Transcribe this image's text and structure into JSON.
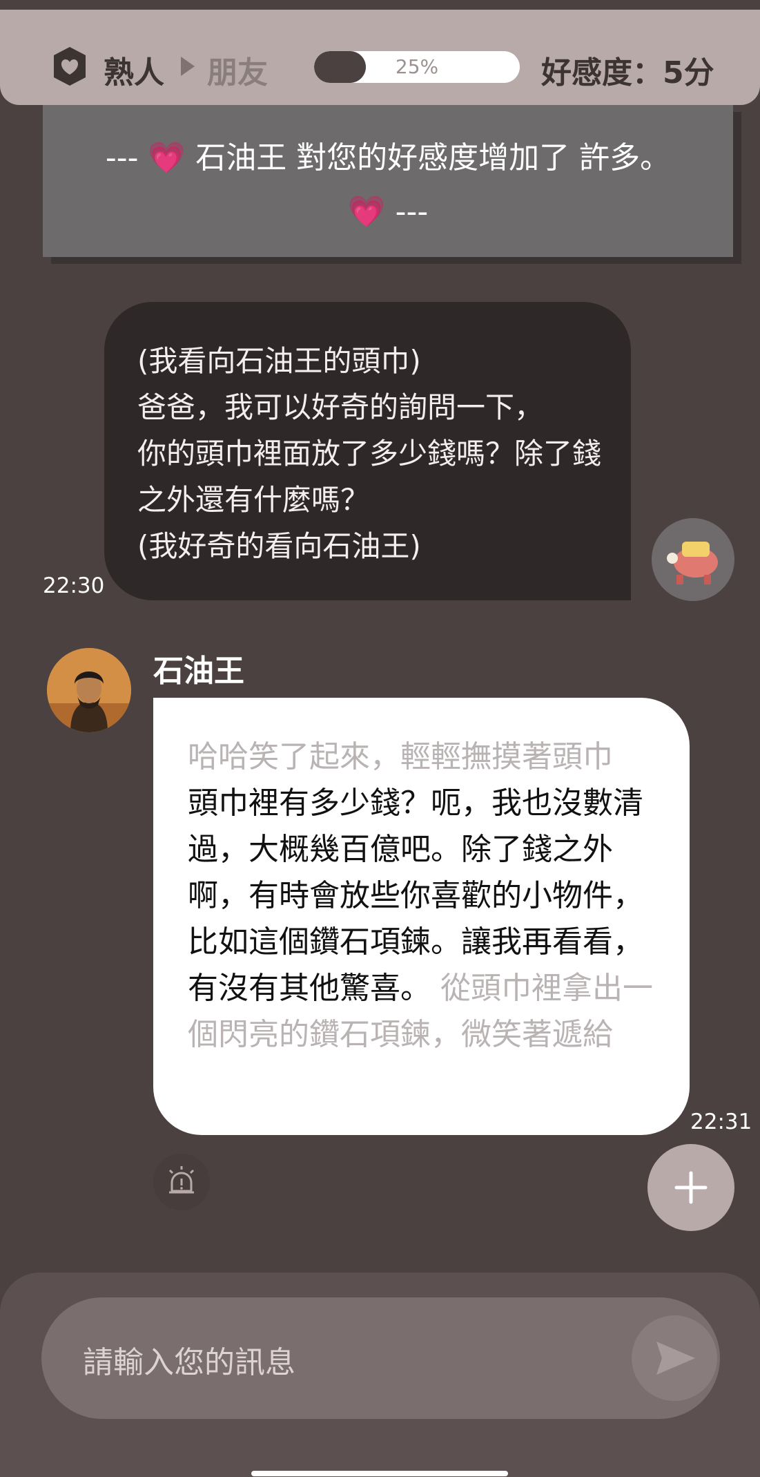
{
  "header": {
    "relation_from": "熟人",
    "relation_to": "朋友",
    "progress_text": "25%",
    "progress_value": 0.25,
    "affection_label": "好感度：5分"
  },
  "notice": {
    "text": "--- 💗 石油王 對您的好感度增加了 許多。 💗 ---"
  },
  "messages": {
    "user": {
      "text": "(我看向石油王的頭巾)\n爸爸，我可以好奇的詢問一下，\n你的頭巾裡面放了多少錢嗎？除了錢之外還有什麼嗎？\n(我好奇的看向石油王)",
      "time": "22:30"
    },
    "bot": {
      "name": "石油王",
      "action1": "哈哈笑了起來，輕輕撫摸著頭巾",
      "speech": "頭巾裡有多少錢？呃，我也沒數清過，大概幾百億吧。除了錢之外啊，有時會放些你喜歡的小物件，比如這個鑽石項鍊。讓我再看看，有沒有其他驚喜。",
      "action2": "從頭巾裡拿出一個閃亮的鑽石項鍊，微笑著遞給",
      "time": "22:31"
    }
  },
  "composer": {
    "placeholder": "請輸入您的訊息"
  },
  "colors": {
    "background": "#4b4140",
    "header": "#b8aaa8",
    "user_bubble": "#2f2828",
    "bot_bubble": "#ffffff",
    "dim_text": "#b9b3b3"
  },
  "icons": [
    "shield-heart-icon",
    "triangle-right-icon",
    "alarm-icon",
    "plus-icon",
    "send-icon"
  ]
}
